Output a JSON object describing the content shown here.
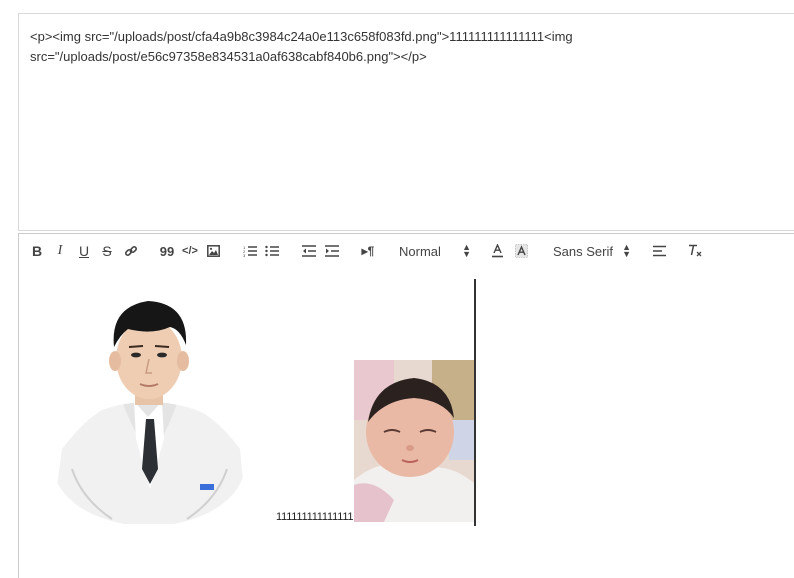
{
  "field": {
    "label": " "
  },
  "source_view": {
    "html_text": "<p><img src=\"/uploads/post/cfa4a9b8c3984c24a0e113c658f083fd.png\">111111111111111<img src=\"/uploads/post/e56c97358e834531a0af638cabf840b6.png\"></p>"
  },
  "toolbar": {
    "bold_label": "B",
    "italic_label": "I",
    "underline_label": "U",
    "strike_label": "S",
    "quote_label": "99",
    "code_label": "</>",
    "header_value": "Normal",
    "font_value": "Sans Serif",
    "icons": [
      "bold-icon",
      "italic-icon",
      "underline-icon",
      "strike-icon",
      "link-icon",
      "blockquote-icon",
      "code-block-icon",
      "image-icon",
      "ordered-list-icon",
      "bullet-list-icon",
      "outdent-icon",
      "indent-icon",
      "rtl-direction-icon",
      "text-color-icon",
      "background-color-icon",
      "align-icon",
      "clear-format-icon"
    ]
  },
  "editor": {
    "inline_text": "111111111111111",
    "images": [
      "doctor-portrait",
      "baby-photo"
    ]
  },
  "colors": {
    "border": "#cccccc",
    "text": "#444444",
    "background": "#ffffff"
  }
}
